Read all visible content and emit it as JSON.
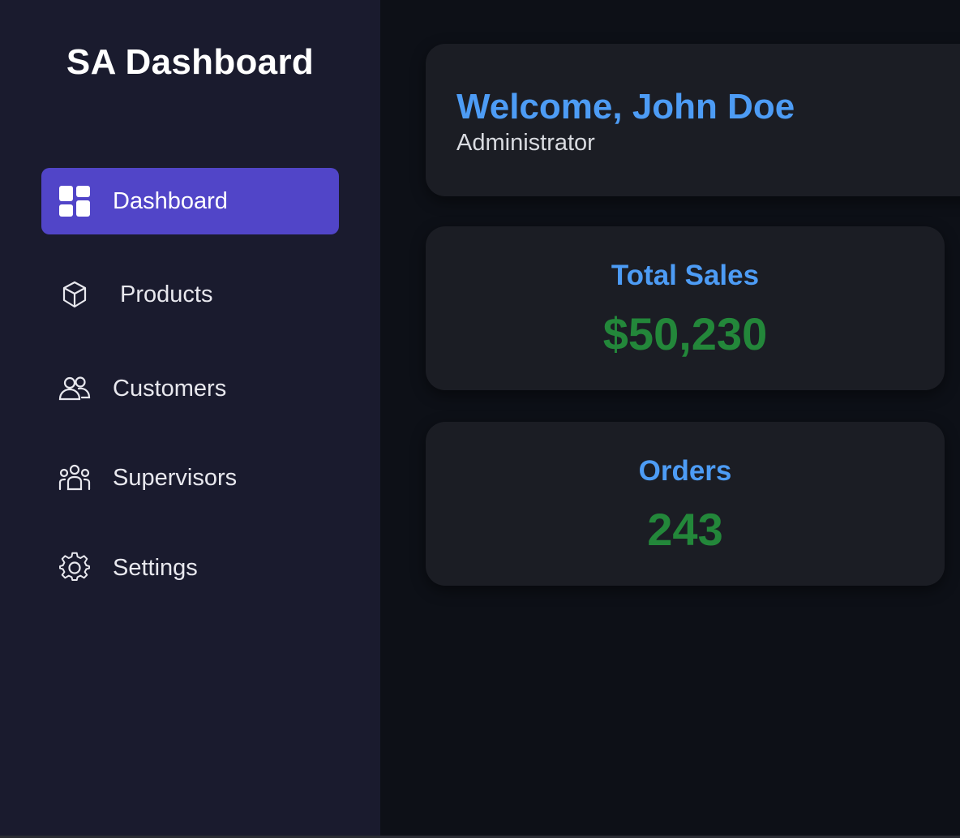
{
  "sidebar": {
    "brand": "SA Dashboard",
    "items": [
      {
        "label": "Dashboard",
        "icon": "dashboard-grid-icon",
        "active": true
      },
      {
        "label": "Products",
        "icon": "cube-icon",
        "active": false
      },
      {
        "label": "Customers",
        "icon": "users-icon",
        "active": false
      },
      {
        "label": "Supervisors",
        "icon": "group-icon",
        "active": false
      },
      {
        "label": "Settings",
        "icon": "gear-icon",
        "active": false
      }
    ]
  },
  "welcome": {
    "title": "Welcome, John Doe",
    "role": "Administrator"
  },
  "stats": [
    {
      "title": "Total Sales",
      "value": "$50,230"
    },
    {
      "title": "Orders",
      "value": "243"
    }
  ],
  "colors": {
    "sidebar_bg": "#1a1b2e",
    "main_bg": "#0d1017",
    "card_bg": "#1b1d24",
    "accent": "#5145c8",
    "heading_blue": "#4d9cf5",
    "value_green": "#23873a"
  }
}
